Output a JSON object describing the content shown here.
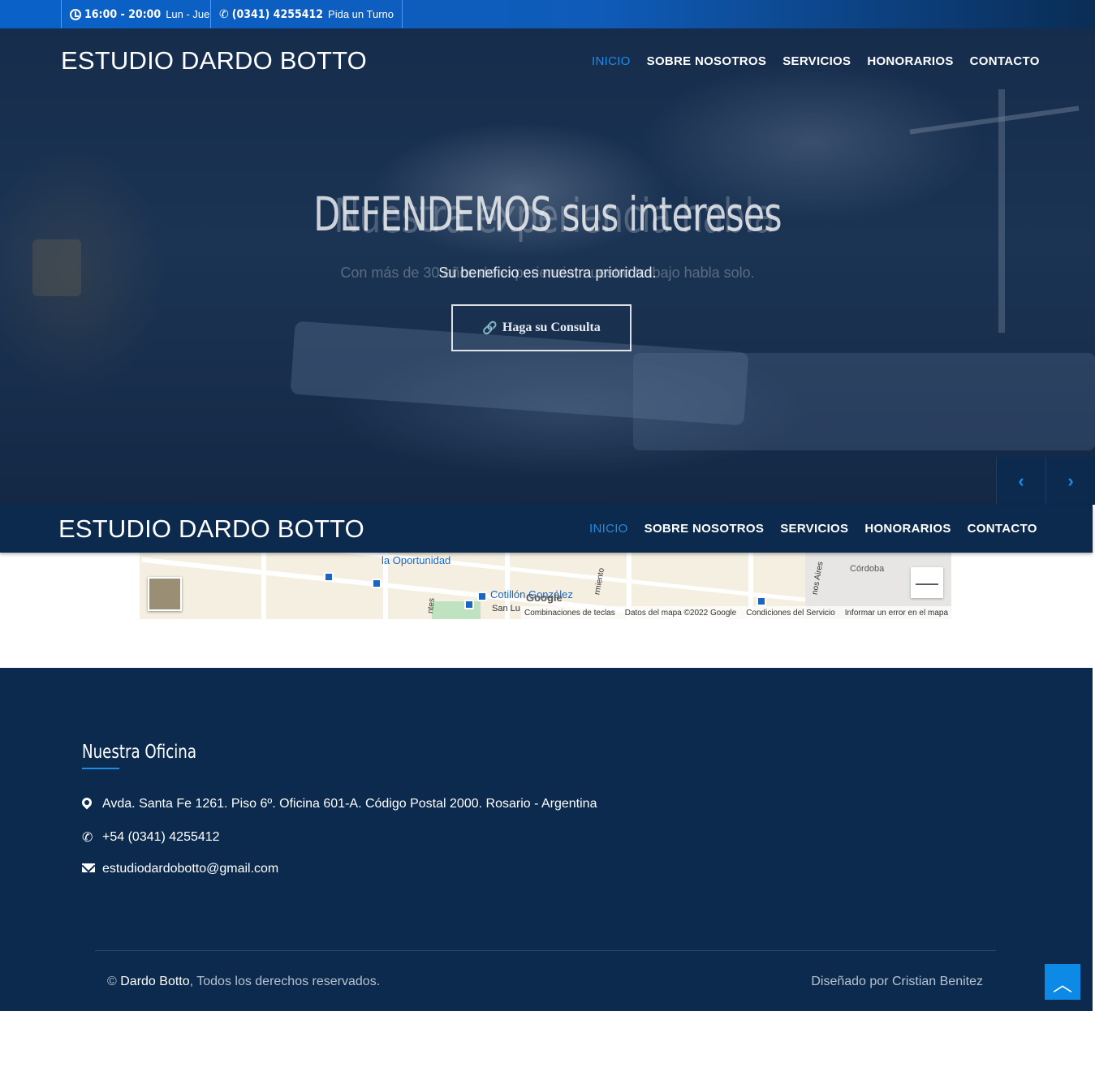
{
  "topbar": {
    "hours": "16:00 - 20:00",
    "days": "Lun - Jue",
    "phone": "(0341) 4255412",
    "phone_cta": "Pida un Turno"
  },
  "brand": "ESTUDIO DARDO BOTTO",
  "nav": {
    "items": [
      "INICIO",
      "SOBRE NOSOTROS",
      "SERVICIOS",
      "HONORARIOS",
      "CONTACTO"
    ],
    "active": "INICIO"
  },
  "hero": {
    "title": "DEFENDEMOS sus intereses",
    "title_ghost": "Nuestra experiencia habla",
    "subtitle": "Su beneficio es nuestra prioridad.",
    "subtitle_ghost": "Con más de 30 años de experiencia, nuestro trabajo habla solo.",
    "button": "Haga su Consulta",
    "prev_icon": "chevron-left",
    "next_icon": "chevron-right"
  },
  "map": {
    "labels": [
      "la Oportunidad",
      "Cotillón González",
      "Córdoba",
      "San Lu",
      "ntes",
      "rmiento",
      "nos Aires"
    ],
    "google": "Google",
    "attribution": [
      "Combinaciones de teclas",
      "Datos del mapa ©2022 Google",
      "Condiciones del Servicio",
      "Informar un error en el mapa"
    ],
    "zoom_out": "—"
  },
  "footer": {
    "office_title": "Nuestra Oficina",
    "address": "Avda. Santa Fe 1261. Piso 6º. Oficina 601-A. Código Postal 2000. Rosario - Argentina",
    "phone": "+54 (0341) 4255412",
    "email": "estudiodardobotto@gmail.com",
    "copyright_symbol": "©",
    "copyright_name": "Dardo Botto",
    "copyright_rest": ", Todos los derechos reservados.",
    "designed_by": "Diseñado por Cristian Benitez"
  },
  "colors": {
    "navy": "#0b2a4e",
    "accent": "#1e8ce6",
    "topbar": "#0a62c9"
  }
}
